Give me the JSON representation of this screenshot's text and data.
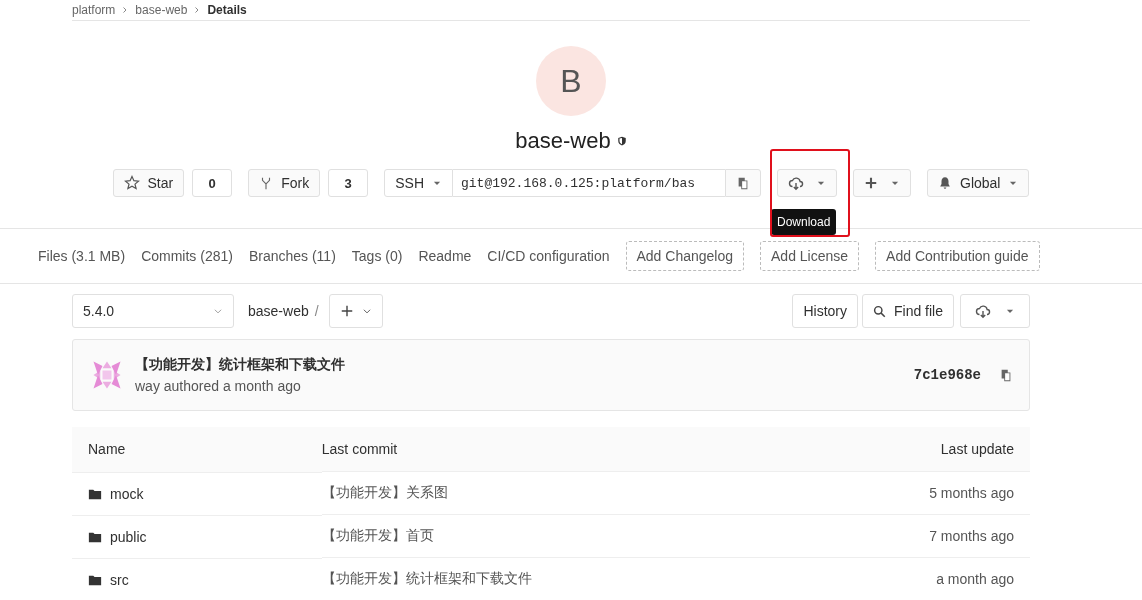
{
  "breadcrumb": [
    "platform",
    "base-web",
    "Details"
  ],
  "project": {
    "avatar_letter": "B",
    "name": "base-web"
  },
  "actions": {
    "star": {
      "label": "Star",
      "count": "0"
    },
    "fork": {
      "label": "Fork",
      "count": "3"
    },
    "clone": {
      "protocol": "SSH",
      "url": "git@192.168.0.125:platform/bas"
    },
    "notification": {
      "label": "Global"
    }
  },
  "tooltip": {
    "text": "Download"
  },
  "nav": [
    {
      "label": "Files (3.1 MB)",
      "kind": "link"
    },
    {
      "label": "Commits (281)",
      "kind": "link"
    },
    {
      "label": "Branches (11)",
      "kind": "link"
    },
    {
      "label": "Tags (0)",
      "kind": "link"
    },
    {
      "label": "Readme",
      "kind": "link"
    },
    {
      "label": "CI/CD configuration",
      "kind": "link"
    },
    {
      "label": "Add Changelog",
      "kind": "dashed"
    },
    {
      "label": "Add License",
      "kind": "dashed"
    },
    {
      "label": "Add Contribution guide",
      "kind": "dashed"
    }
  ],
  "toolbar": {
    "branch": "5.4.0",
    "path": "base-web",
    "separator": "/",
    "history": "History",
    "find_file": "Find file"
  },
  "last_commit": {
    "message": "【功能开发】统计框架和下载文件",
    "author_line": "way authored a month ago",
    "sha": "7c1e968e"
  },
  "table": {
    "columns": [
      "Name",
      "Last commit",
      "Last update"
    ],
    "rows": [
      {
        "name": "mock",
        "commit": "【功能开发】关系图",
        "updated": "5 months ago"
      },
      {
        "name": "public",
        "commit": "【功能开发】首页",
        "updated": "7 months ago"
      },
      {
        "name": "src",
        "commit": "【功能开发】统计框架和下载文件",
        "updated": "a month ago"
      }
    ]
  }
}
